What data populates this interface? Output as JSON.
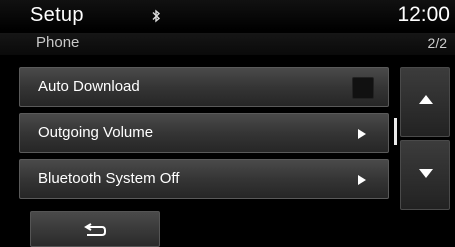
{
  "header": {
    "title": "Setup",
    "bluetooth_icon": "bluetooth-icon",
    "clock": "12:00"
  },
  "subheader": {
    "section": "Phone",
    "page": "2/2"
  },
  "list": {
    "items": [
      {
        "label": "Auto Download",
        "control": "checkbox",
        "checked": false
      },
      {
        "label": "Outgoing Volume",
        "control": "arrow-right-icon"
      },
      {
        "label": "Bluetooth System Off",
        "control": "arrow-right-icon"
      }
    ]
  },
  "scroll": {
    "up_icon": "arrow-up-icon",
    "down_icon": "arrow-down-icon"
  },
  "footer": {
    "back_icon": "back-icon"
  }
}
